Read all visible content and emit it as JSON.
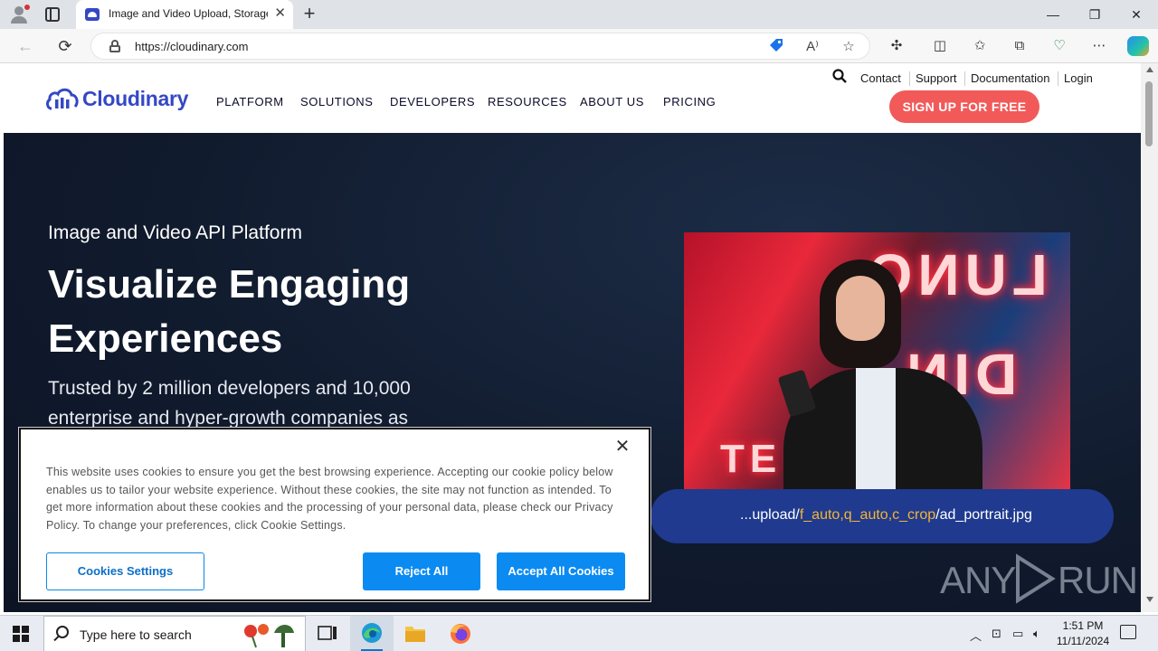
{
  "browser": {
    "tab_title": "Image and Video Upload, Storage",
    "tab_close": "✕",
    "new_tab": "+",
    "url": "https://cloudinary.com",
    "window_controls": {
      "minimize": "—",
      "restore": "❐",
      "close": "✕"
    }
  },
  "site": {
    "logo_text": "Cloudinary",
    "brand_color": "#3448c5",
    "nav": [
      "PLATFORM",
      "SOLUTIONS",
      "DEVELOPERS",
      "RESOURCES",
      "ABOUT US",
      "PRICING"
    ],
    "utility_links": [
      "Contact",
      "Support",
      "Documentation",
      "Login"
    ],
    "signup_label": "SIGN UP FOR FREE",
    "signup_color": "#f15a59"
  },
  "hero": {
    "eyebrow": "Image and Video API Platform",
    "title": "Visualize Engaging Experiences",
    "subtitle": "Trusted by 2 million developers and 10,000 enterprise and hyper-growth companies as",
    "url_prefix": "...upload/",
    "url_transform": "f_auto,q_auto,c_crop",
    "url_suffix": "/ad_portrait.jpg",
    "photo_neon": [
      "LUNC",
      "DIN",
      "TE"
    ]
  },
  "watermark": {
    "left": "ANY",
    "right": "RUN"
  },
  "cookie_dialog": {
    "text": "This website uses cookies to ensure you get the best browsing experience. Accepting our cookie policy below enables us to tailor your website experience. Without these cookies, the site may not function as intended. To get more information about these cookies and the processing of your personal data, please check our Privacy Policy. To change your preferences, click Cookie Settings.",
    "close": "✕",
    "settings_label": "Cookies Settings",
    "reject_label": "Reject All",
    "accept_label": "Accept All Cookies",
    "button_color": "#0b8bf2"
  },
  "taskbar": {
    "search_placeholder": "Type here to search",
    "time": "1:51 PM",
    "date": "11/11/2024",
    "apps": [
      "task-view",
      "edge",
      "file-explorer",
      "firefox"
    ]
  }
}
